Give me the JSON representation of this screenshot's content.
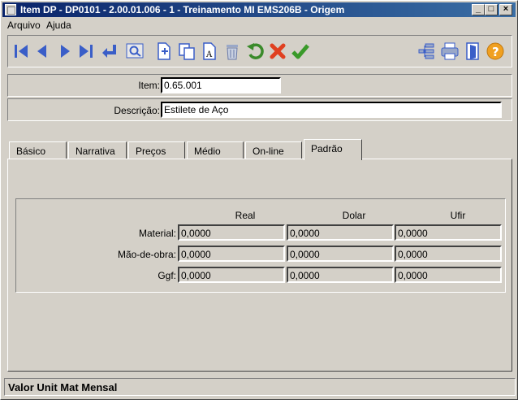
{
  "window": {
    "title": "Item DP - DP0101 - 2.00.01.006 - 1 - Treinamento MI    EMS206B - Origem",
    "buttons": {
      "minimize": "_",
      "maximize": "□",
      "close": "×"
    }
  },
  "menu": {
    "items": [
      "Arquivo",
      "Ajuda"
    ]
  },
  "toolbar": {
    "icons": [
      "first-icon",
      "prev-icon",
      "next-icon",
      "last-icon",
      "return-icon",
      "zoom-icon",
      "new-icon",
      "copy-icon",
      "edit-icon",
      "delete-icon",
      "undo-icon",
      "cancel-icon",
      "confirm-icon",
      "tree-icon",
      "print-icon",
      "exit-icon",
      "help-icon"
    ]
  },
  "form": {
    "item_label": "Item:",
    "item_value": "0.65.001",
    "descricao_label": "Descrição:",
    "descricao_value": "Estilete de Aço"
  },
  "tabs": [
    "Básico",
    "Narrativa",
    "Preços",
    "Médio",
    "On-line",
    "Padrão"
  ],
  "active_tab": "Padrão",
  "padrao": {
    "columns": [
      "Real",
      "Dolar",
      "Ufir"
    ],
    "rows": [
      {
        "label": "Material:",
        "values": [
          "0,0000",
          "0,0000",
          "0,0000"
        ]
      },
      {
        "label": "Mão-de-obra:",
        "values": [
          "0,0000",
          "0,0000",
          "0,0000"
        ]
      },
      {
        "label": "Ggf:",
        "values": [
          "0,0000",
          "0,0000",
          "0,0000"
        ]
      }
    ]
  },
  "status": {
    "text": "Valor Unit Mat Mensal"
  },
  "colors": {
    "title_start": "#0a246a",
    "title_end": "#3a6ea5",
    "face": "#d4d0c8"
  }
}
